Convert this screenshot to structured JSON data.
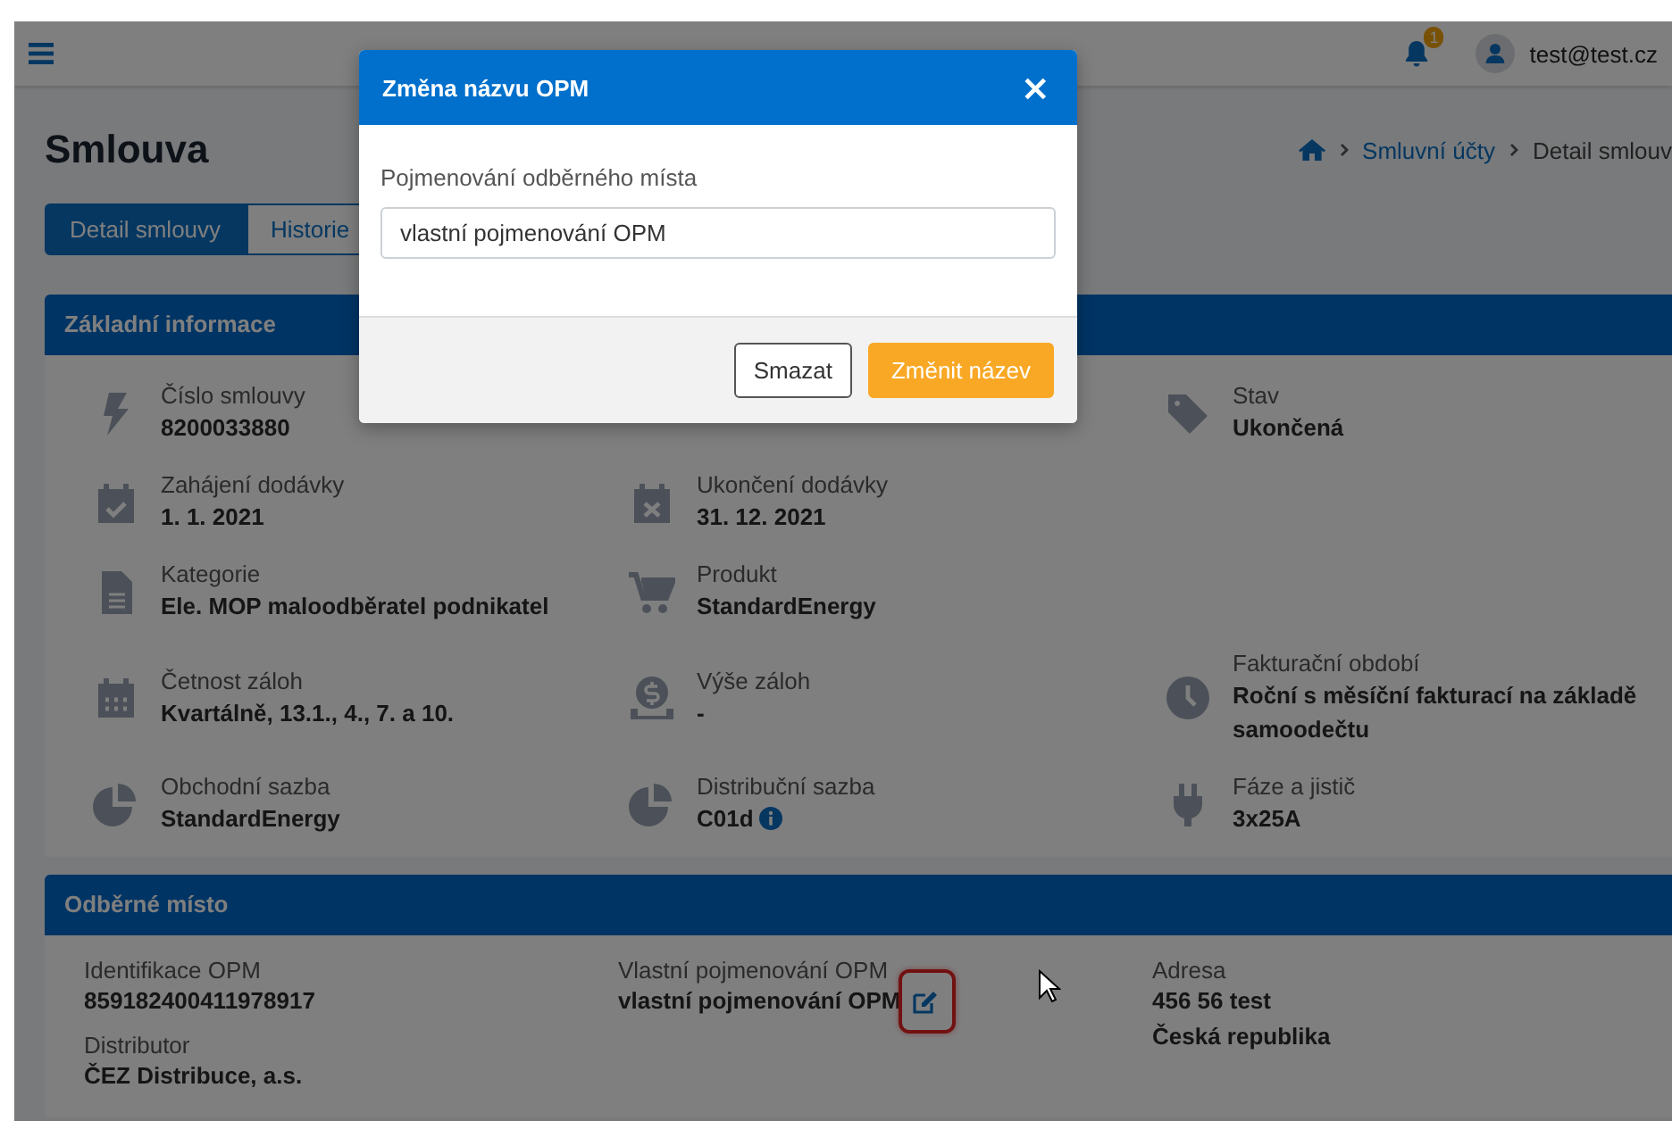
{
  "top_bar": {
    "notification_count": "1",
    "user": "test@test.cz"
  },
  "page": {
    "title": "Smlouva",
    "breadcrumb": [
      "Smluvní účty",
      "Detail smlouv"
    ],
    "tabs": [
      {
        "label": "Detail smlouvy",
        "selected": true
      },
      {
        "label": "Historie",
        "selected": false
      }
    ]
  },
  "contract_card": {
    "title": "Základní informace",
    "rows": [
      {
        "items": [
          {
            "label": "Číslo smlouvy",
            "value": "8200033880"
          },
          {
            "label": "Stav",
            "value": "Ukončená"
          }
        ]
      },
      {
        "items": [
          {
            "label": "Zahájení dodávky",
            "value": "1. 1. 2021"
          },
          {
            "label": "Ukončení dodávky",
            "value": "31. 12. 2021"
          }
        ]
      },
      {
        "items": [
          {
            "label": "Kategorie",
            "value": "Ele. MOP maloodběratel podnikatel"
          },
          {
            "label": "Produkt",
            "value": "StandardEnergy"
          }
        ]
      },
      {
        "items": [
          {
            "label": "Četnost záloh",
            "value": "Kvartálně, 13.1., 4., 7. a 10."
          },
          {
            "label": "Výše záloh",
            "value": "-"
          },
          {
            "label": "Fakturační období",
            "value": "Roční s měsíční fakturací na základě samoodečtu"
          }
        ]
      },
      {
        "items": [
          {
            "label": "Obchodní sazba",
            "value": "StandardEnergy"
          },
          {
            "label": "Distribuční sazba",
            "value": "C01d",
            "info": true
          },
          {
            "label": "Fáze a jistič",
            "value": "3x25A"
          }
        ]
      }
    ]
  },
  "supply_point_card": {
    "title": "Odběrné místo",
    "columns": [
      {
        "items": [
          {
            "label": "Identifikace OPM",
            "lines": [
              "859182400411978917"
            ],
            "editable": false
          },
          {
            "label": "Distributor",
            "lines": [
              "ČEZ Distribuce, a.s."
            ],
            "editable": false
          }
        ]
      },
      {
        "items": [
          {
            "label": "Vlastní pojmenování OPM",
            "lines": [
              "vlastní pojmenování OPM"
            ],
            "editable": true,
            "highlighted": true
          }
        ]
      },
      {
        "items": [
          {
            "label": "Adresa",
            "lines": [
              "456 56 test",
              "Česká republika"
            ],
            "editable": false
          }
        ]
      }
    ]
  },
  "modal": {
    "title": "Změna názvu OPM",
    "close": "×",
    "field_label": "Pojmenování odběrného místa",
    "value": "vlastní pojmenování OPM",
    "buttons": [
      {
        "label": "Smazat",
        "kind": "secondary"
      },
      {
        "label": "Změnit název",
        "kind": "primary"
      }
    ]
  }
}
